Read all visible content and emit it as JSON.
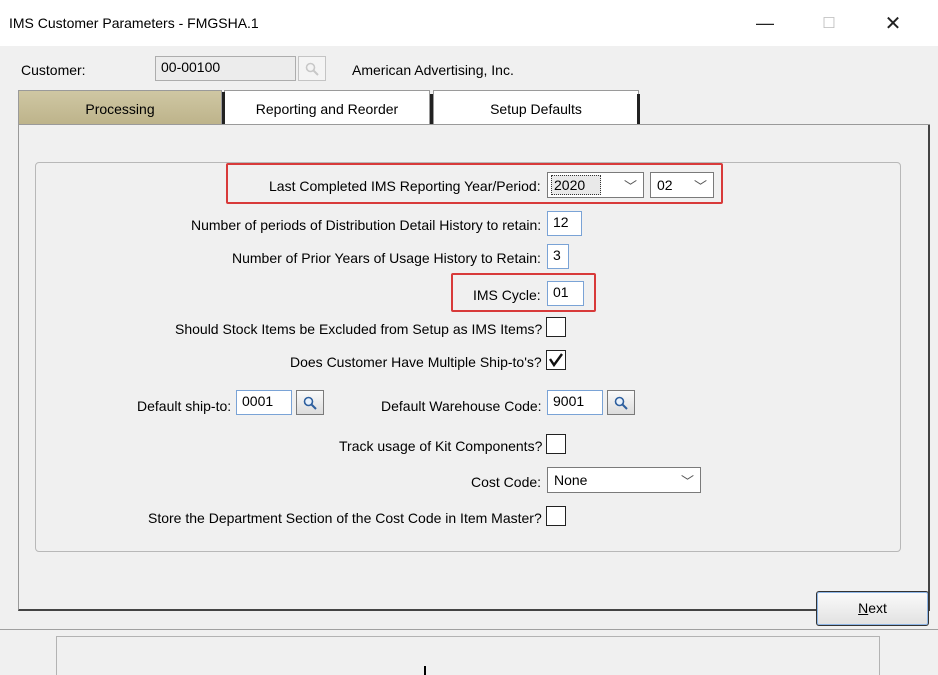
{
  "window": {
    "title": "IMS Customer Parameters - FMGSHA.1",
    "minimize_glyph": "—",
    "maximize_glyph": "☐",
    "close_glyph": "✕"
  },
  "customer": {
    "label": "Customer:",
    "code": "00-00100",
    "name": "American Advertising, Inc."
  },
  "tabs": [
    {
      "label": "Processing",
      "active": true
    },
    {
      "label": "Reporting and Reorder",
      "active": false
    },
    {
      "label": "Setup Defaults",
      "active": false
    }
  ],
  "form": {
    "last_completed": {
      "label": "Last Completed IMS Reporting Year/Period:",
      "year": "2020",
      "period": "02"
    },
    "distribution_history": {
      "label": "Number of periods of Distribution Detail History to retain:",
      "value": "12"
    },
    "usage_history": {
      "label": "Number of Prior Years of Usage History to Retain:",
      "value": "3"
    },
    "ims_cycle": {
      "label": "IMS Cycle:",
      "value": "01"
    },
    "exclude_stock": {
      "label": "Should Stock Items be Excluded from Setup as IMS Items?",
      "checked": false
    },
    "multiple_shipto": {
      "label": "Does Customer Have Multiple Ship-to's?",
      "checked": true
    },
    "default_shipto": {
      "label": "Default ship-to:",
      "value": "0001"
    },
    "default_warehouse": {
      "label": "Default Warehouse Code:",
      "value": "9001"
    },
    "track_kit": {
      "label": "Track usage of Kit Components?",
      "checked": false
    },
    "cost_code": {
      "label": "Cost Code:",
      "value": "None"
    },
    "store_department": {
      "label": "Store the Department Section of the Cost Code in Item Master?",
      "checked": false
    }
  },
  "buttons": {
    "next_mnemonic": "N",
    "next_rest": "ext"
  },
  "icons": {
    "lookup": "magnifier-icon",
    "dropdown": "chevron-down-icon",
    "check": "check-icon"
  },
  "colors": {
    "active_tab": "#c6bd97",
    "highlight": "#d83a3a"
  }
}
